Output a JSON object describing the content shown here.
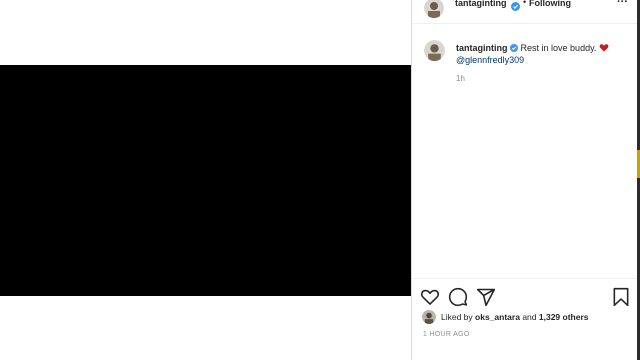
{
  "post": {
    "username": "tantaginting",
    "follow_status": "Following",
    "dot": "•",
    "more_label": "···",
    "caption": {
      "username": "tantaginting",
      "text": "Rest in love buddy.",
      "mention": "@glennfredly309",
      "age": "1h"
    },
    "likes": {
      "prefix": "Liked by",
      "user": "oks_antara",
      "and": "and",
      "others": "1,329 others"
    },
    "posted": "1 HOUR AGO"
  },
  "colors": {
    "video_bg": "#000000",
    "verified": "#3897f0",
    "heart": "#ed4956",
    "muted": "#8e8e8e",
    "mention": "#00376b"
  },
  "icons": [
    "verified-badge-icon",
    "heart-emoji-icon",
    "like-heart-icon",
    "comment-icon",
    "share-icon",
    "bookmark-icon",
    "more-options-icon"
  ]
}
